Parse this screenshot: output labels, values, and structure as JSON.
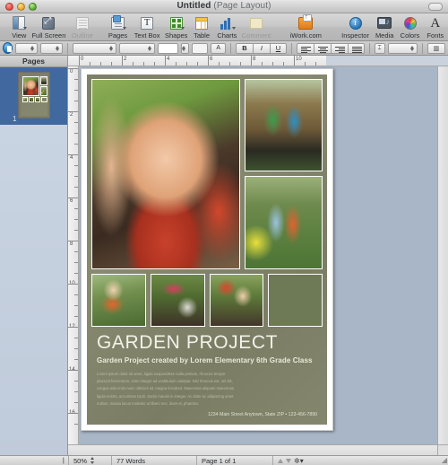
{
  "window": {
    "title": "Untitled",
    "subtitle": "(Page Layout)",
    "traffic_lights": [
      "close",
      "minimize",
      "zoom"
    ]
  },
  "toolbar": {
    "items": [
      {
        "label": "View",
        "icon": "view-icon",
        "has_menu": true,
        "dimmed": false
      },
      {
        "label": "Full Screen",
        "icon": "full-screen-icon",
        "has_menu": false,
        "dimmed": false
      },
      {
        "label": "Outline",
        "icon": "outline-icon",
        "has_menu": false,
        "dimmed": true
      },
      {
        "label": "Pages",
        "icon": "pages-icon",
        "has_menu": true,
        "dimmed": false
      },
      {
        "label": "Text Box",
        "icon": "text-box-icon",
        "has_menu": false,
        "dimmed": false
      },
      {
        "label": "Shapes",
        "icon": "shapes-icon",
        "has_menu": true,
        "dimmed": false
      },
      {
        "label": "Table",
        "icon": "table-icon",
        "has_menu": false,
        "dimmed": false
      },
      {
        "label": "Charts",
        "icon": "charts-icon",
        "has_menu": true,
        "dimmed": false
      },
      {
        "label": "Comment",
        "icon": "comment-icon",
        "has_menu": false,
        "dimmed": true
      },
      {
        "label": "iWork.com",
        "icon": "iwork-share-icon",
        "has_menu": false,
        "dimmed": false
      },
      {
        "label": "Inspector",
        "icon": "inspector-icon",
        "has_menu": false,
        "dimmed": false
      },
      {
        "label": "Media",
        "icon": "media-icon",
        "has_menu": false,
        "dimmed": false
      },
      {
        "label": "Colors",
        "icon": "colors-icon",
        "has_menu": false,
        "dimmed": false
      },
      {
        "label": "Fonts",
        "icon": "fonts-icon",
        "has_menu": false,
        "dimmed": false
      }
    ]
  },
  "format_bar": {
    "style_drawer_icon": "style-drawer-icon",
    "paragraph_style": "",
    "list_style": "",
    "font_family": "",
    "font_typeface": "",
    "font_size": "",
    "font_color_swatch": "",
    "text_color_icon": "text-color-icon",
    "bold": "B",
    "italic": "I",
    "underline": "U",
    "align": [
      "align-left",
      "align-center",
      "align-right",
      "align-justify"
    ],
    "line_spacing_icon": "line-spacing-icon",
    "line_spacing_value": "",
    "columns_icon": "columns-icon"
  },
  "sidebar": {
    "header": "Pages",
    "thumbnails": [
      {
        "number": "1",
        "selected": true
      }
    ]
  },
  "rulers": {
    "horizontal_ticks": [
      "0",
      "2",
      "4",
      "6",
      "8",
      "10"
    ],
    "vertical_ticks": [
      "0",
      "2",
      "4",
      "6",
      "8",
      "10",
      "12",
      "14",
      "16"
    ],
    "units": "inches"
  },
  "document": {
    "headline": "GARDEN PROJECT",
    "subhead": "Garden Project created by Lorem Elementary 6th Grade Class",
    "body": "Lorem ipsum dolor sit amet, ligula suspendisse nulla pretium, rhoncus tempor placerat fermentum, enim integer ad vestibulum volutpat. Nisl rhoncus est, vel elit, congue wisi enim nunc ultricies sit, magna tincidunt. Maecenas aliquam maecenas ligula nostra, accumsan taciti. Sociis mauris in integer. Ac dolor ac adipiscing amet nullam, massa lacus molestie ut libero nec, diam et, pharetra.",
    "footer": "1234 Main Street Anytown, State ZIP • 123-456-7890",
    "photos": [
      {
        "name": "girl-blowing-seeds",
        "position": "hero-left"
      },
      {
        "name": "two-students-on-garden-structure",
        "position": "right-top"
      },
      {
        "name": "boy-and-girl-standing-in-garden",
        "position": "right-bottom"
      },
      {
        "name": "boy-with-garden-tool",
        "position": "bottom-1"
      },
      {
        "name": "watering-can-and-plants",
        "position": "bottom-2"
      },
      {
        "name": "students-planting-seedlings",
        "position": "bottom-3"
      },
      {
        "name": "lettuce-in-soil",
        "position": "bottom-4"
      }
    ],
    "theme_colors": {
      "page_background": "#82856c",
      "headline": "#f1f2e9",
      "subhead": "#e8ead8",
      "body_text": "#b9bda4"
    }
  },
  "status_bar": {
    "zoom": "50%",
    "word_count": "77 Words",
    "page_indicator": "Page 1 of 1",
    "prev_icon": "nav-up-icon",
    "next_icon": "nav-down-icon",
    "settings_icon": "gear-icon"
  }
}
